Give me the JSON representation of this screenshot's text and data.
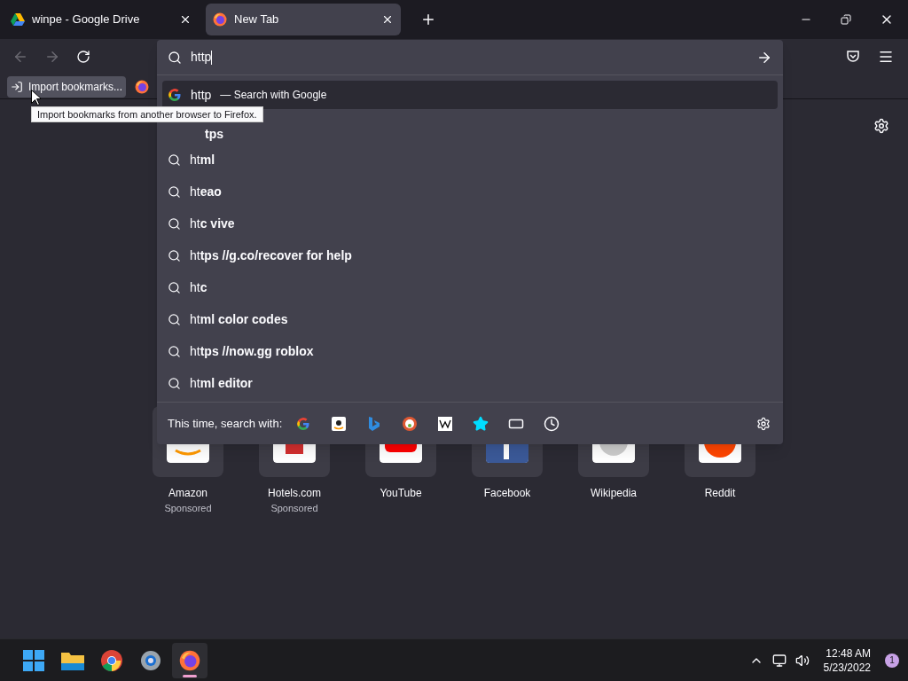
{
  "tabs": [
    {
      "kind": "drive",
      "title": "winpe - Google Drive",
      "selected": false
    },
    {
      "kind": "firefox",
      "title": "New Tab",
      "selected": true
    }
  ],
  "toolbar": {
    "back_disabled": true,
    "forward_disabled": true
  },
  "bookmarks": [
    {
      "kind": "import",
      "label": "Import bookmarks..."
    },
    {
      "kind": "firefox"
    }
  ],
  "tooltip": "Import bookmarks from another browser to Firefox.",
  "urlbar": {
    "value": "http",
    "first_result": {
      "query": "http",
      "action": "— Search with Google",
      "selected": true
    },
    "suggestions": [
      {
        "rest": "tps"
      },
      {
        "typed": "ht",
        "rest": "ml"
      },
      {
        "typed": "ht",
        "rest": "eao"
      },
      {
        "typed": "ht",
        "rest": "c vive"
      },
      {
        "typed": "ht",
        "rest": "tps //g.co/recover for help"
      },
      {
        "typed": "ht",
        "rest": "c"
      },
      {
        "typed": "ht",
        "rest": "ml color codes"
      },
      {
        "typed": "ht",
        "rest": "tps //now.gg roblox"
      },
      {
        "typed": "ht",
        "rest": "ml editor"
      }
    ],
    "footer_label": "This time, search with:",
    "engines": [
      {
        "kind": "google"
      },
      {
        "kind": "amazon"
      },
      {
        "kind": "bing"
      },
      {
        "kind": "duckduckgo"
      },
      {
        "kind": "wikipedia"
      },
      {
        "kind": "bookmarks"
      },
      {
        "kind": "tabs"
      },
      {
        "kind": "history"
      }
    ]
  },
  "top_sites": [
    {
      "kind": "amazon",
      "label": "Amazon",
      "sublabel": "Sponsored"
    },
    {
      "kind": "hotels",
      "label": "Hotels.com",
      "sublabel": "Sponsored"
    },
    {
      "kind": "youtube",
      "label": "YouTube"
    },
    {
      "kind": "facebook",
      "label": "Facebook"
    },
    {
      "kind": "wikipedia",
      "label": "Wikipedia"
    },
    {
      "kind": "reddit",
      "label": "Reddit"
    }
  ],
  "taskbar": {
    "apps": [
      {
        "kind": "start",
        "selected": false
      },
      {
        "kind": "explorer",
        "selected": false
      },
      {
        "kind": "chrome",
        "selected": false
      },
      {
        "kind": "settings",
        "selected": false
      },
      {
        "kind": "firefox",
        "selected": true
      }
    ],
    "time": "12:48 AM",
    "date": "5/23/2022",
    "notifications": "1"
  }
}
